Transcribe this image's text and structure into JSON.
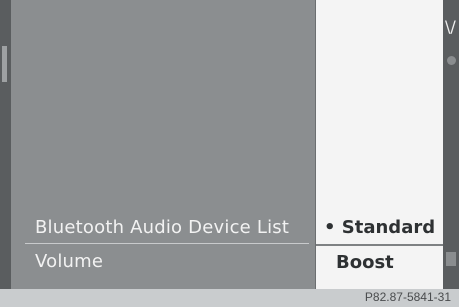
{
  "menu": {
    "items": [
      {
        "label": "Bluetooth Audio Device List"
      },
      {
        "label": "Volume"
      }
    ]
  },
  "submenu": {
    "options": [
      {
        "label": "Standard",
        "selected": true
      },
      {
        "label": "Boost",
        "selected": false
      }
    ],
    "bullet": "•"
  },
  "edge": {
    "glyph": "\\/"
  },
  "caption": "P82.87-5841-31"
}
